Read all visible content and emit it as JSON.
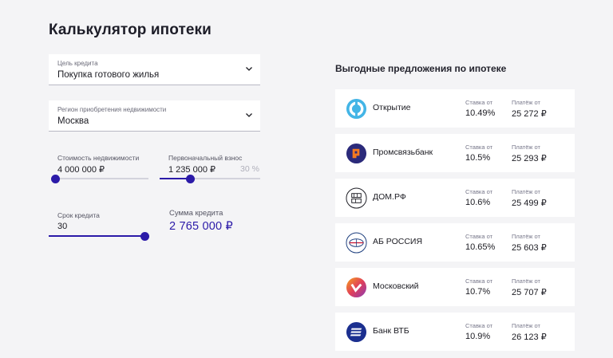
{
  "title": "Калькулятор ипотеки",
  "purpose": {
    "label": "Цель кредита",
    "value": "Покупка готового жилья",
    "icon": "chevron-down-icon"
  },
  "region": {
    "label": "Регион приобретения недвижимости",
    "value": "Москва",
    "icon": "chevron-down-icon"
  },
  "property_cost": {
    "label": "Стоимость недвижимости",
    "value": "4 000 000 ₽",
    "slider_level": 0.0
  },
  "down_payment": {
    "label": "Первоначальный взнос",
    "value": "1 235 000 ₽",
    "percent": "30 %",
    "slider_level": 0.3
  },
  "term": {
    "label": "Срок кредита",
    "value": "30",
    "slider_level": 1.0
  },
  "loan_sum": {
    "label": "Сумма кредита",
    "value": "2 765 000 ₽"
  },
  "offers": {
    "title": "Выгодные предложения по ипотеке",
    "items": [
      {
        "bank": "Открытие",
        "rate_label": "Ставка от",
        "rate": "10.49%",
        "payment_label": "Платёж от",
        "payment": "25 272 ₽",
        "logo": "otkritie-logo-icon",
        "color": "#43b5e6"
      },
      {
        "bank": "Промсвязьбанк",
        "rate_label": "Ставка от",
        "rate": "10.5%",
        "payment_label": "Платёж от",
        "payment": "25 293 ₽",
        "logo": "psb-logo-icon",
        "color": "#2b2a7a"
      },
      {
        "bank": "ДОМ.РФ",
        "rate_label": "Ставка от",
        "rate": "10.6%",
        "payment_label": "Платёж от",
        "payment": "25 499 ₽",
        "logo": "domrf-logo-icon",
        "color": "#1b1b22"
      },
      {
        "bank": "АБ РОССИЯ",
        "rate_label": "Ставка от",
        "rate": "10.65%",
        "payment_label": "Платёж от",
        "payment": "25 603 ₽",
        "logo": "abrossiya-logo-icon",
        "color": "#1a3c7c"
      },
      {
        "bank": "Московский",
        "rate_label": "Ставка от",
        "rate": "10.7%",
        "payment_label": "Платёж от",
        "payment": "25 707 ₽",
        "logo": "mkb-logo-icon",
        "color": "#e0405a"
      },
      {
        "bank": "Банк ВТБ",
        "rate_label": "Ставка от",
        "rate": "10.9%",
        "payment_label": "Платёж от",
        "payment": "26 123 ₽",
        "logo": "vtb-logo-icon",
        "color": "#1b2f8f"
      }
    ]
  },
  "colors": {
    "accent": "#2b1aa8",
    "background": "#f4f4f6"
  }
}
